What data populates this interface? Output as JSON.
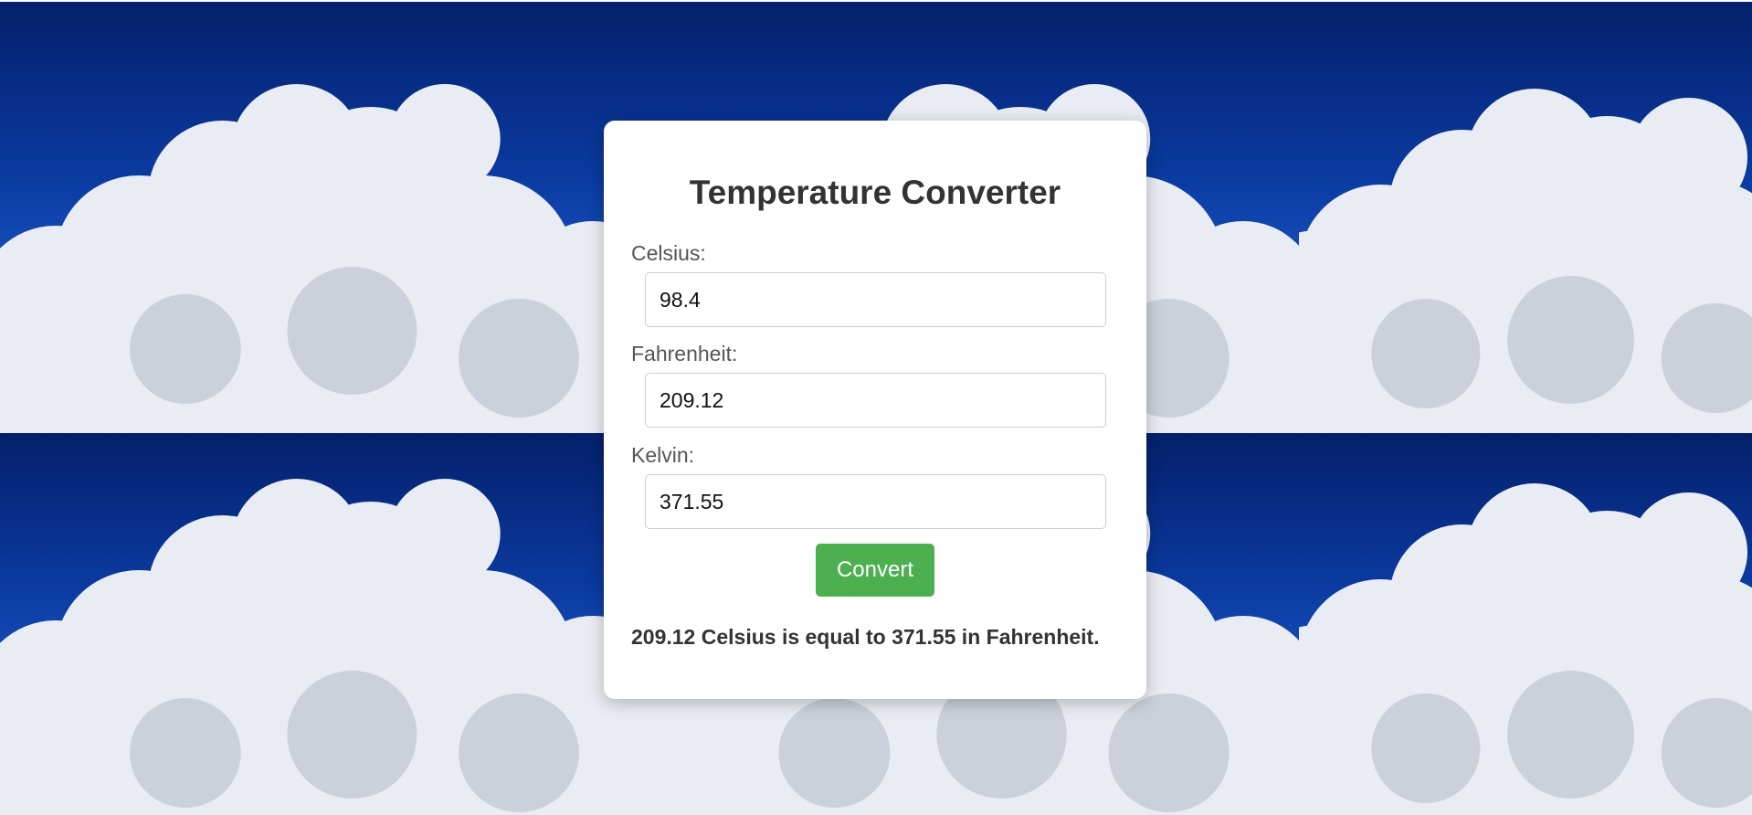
{
  "background": {
    "sky_color": "#0a3aa0",
    "cloud_color": "#e9ecf2"
  },
  "converter": {
    "title": "Temperature Converter",
    "celsius": {
      "label": "Celsius:",
      "value": "98.4"
    },
    "fahrenheit": {
      "label": "Fahrenheit:",
      "value": "209.12"
    },
    "kelvin": {
      "label": "Kelvin:",
      "value": "371.55"
    },
    "convert_label": "Convert",
    "result_text": "209.12 Celsius is equal to 371.55 in Fahrenheit.",
    "accent_color": "#4caf50"
  }
}
